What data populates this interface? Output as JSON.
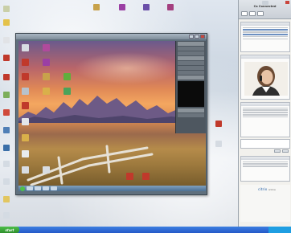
{
  "start_label": "start",
  "sidebar": {
    "title": "Ca Connected"
  },
  "brand": {
    "name": "citrix",
    "suffix": "online"
  },
  "colors": {
    "taskbar": "#2459c8",
    "start": "#2f8f2c",
    "accent": "#2a64a8"
  }
}
